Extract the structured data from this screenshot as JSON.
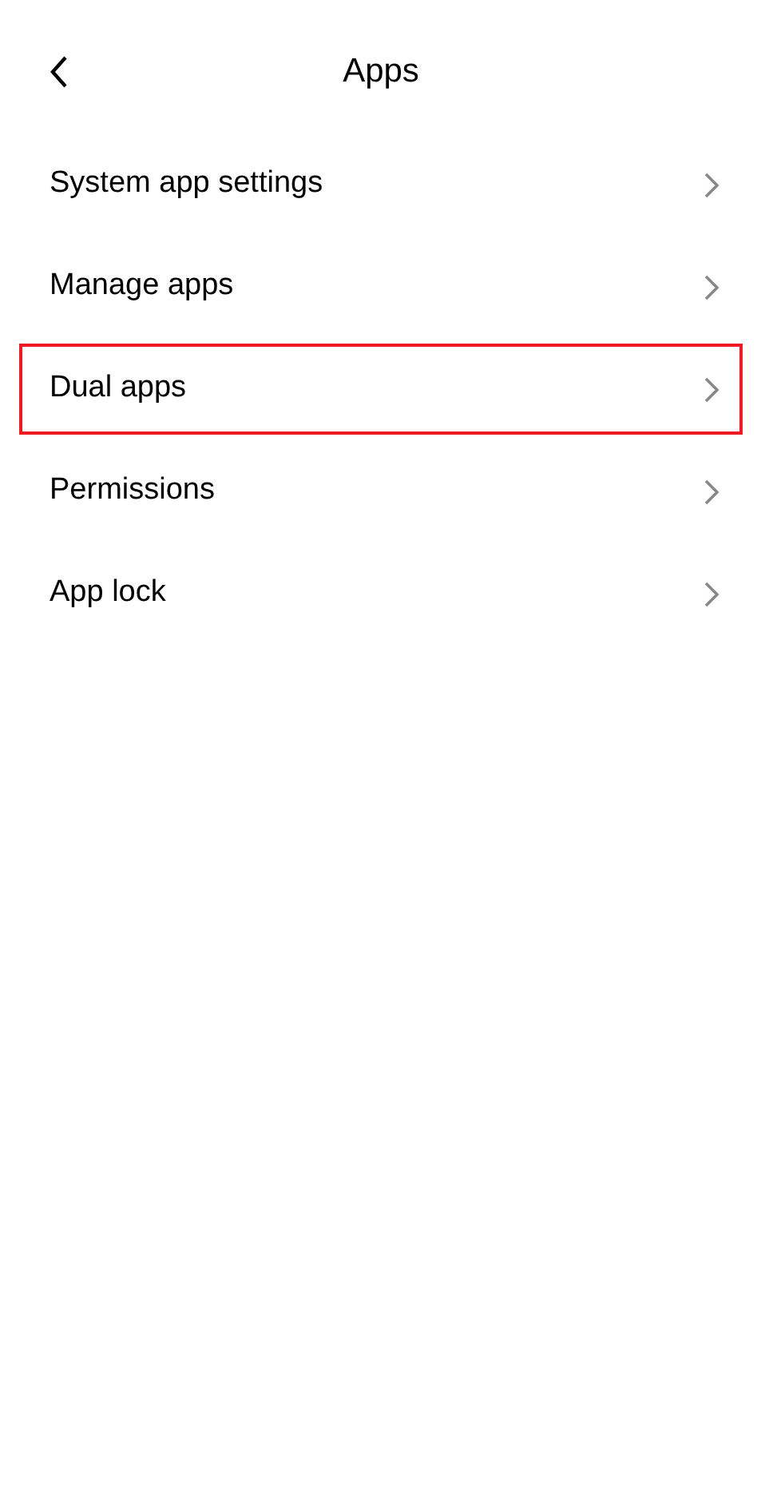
{
  "header": {
    "title": "Apps"
  },
  "items": [
    {
      "label": "System app settings",
      "highlighted": false
    },
    {
      "label": "Manage apps",
      "highlighted": false
    },
    {
      "label": "Dual apps",
      "highlighted": true
    },
    {
      "label": "Permissions",
      "highlighted": false
    },
    {
      "label": "App lock",
      "highlighted": false
    }
  ]
}
